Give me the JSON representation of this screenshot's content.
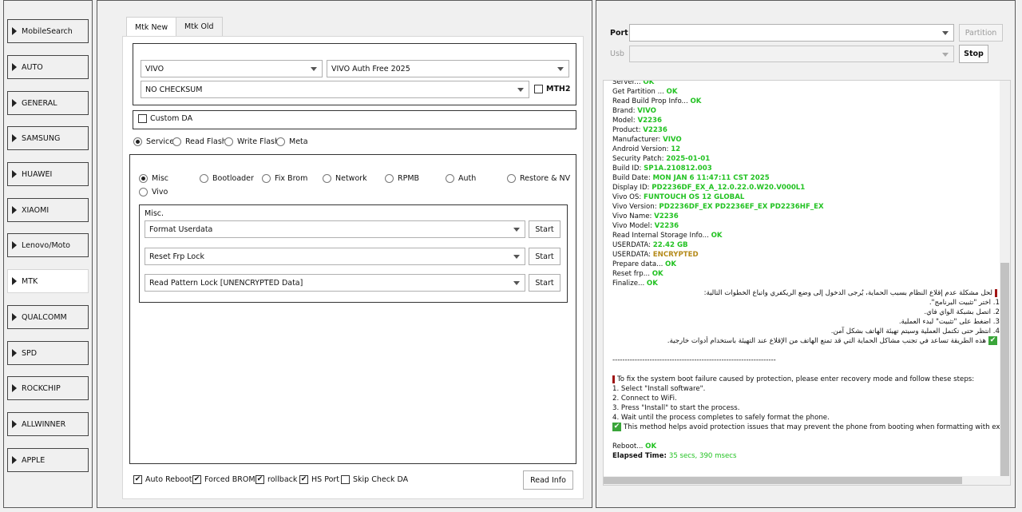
{
  "sidebar": {
    "items": [
      {
        "label": "MobileSearch"
      },
      {
        "label": "AUTO"
      },
      {
        "label": "GENERAL"
      },
      {
        "label": "SAMSUNG"
      },
      {
        "label": "HUAWEI"
      },
      {
        "label": "XIAOMI"
      },
      {
        "label": "Lenovo/Moto"
      },
      {
        "label": "MTK"
      },
      {
        "label": "QUALCOMM"
      },
      {
        "label": "SPD"
      },
      {
        "label": "ROCKCHIP"
      },
      {
        "label": "ALLWINNER"
      },
      {
        "label": "APPLE"
      }
    ],
    "active": "MTK"
  },
  "tabs": [
    {
      "label": "Mtk New"
    },
    {
      "label": "Mtk Old"
    }
  ],
  "device": {
    "brand": "VIVO",
    "auth": "VIVO Auth Free 2025",
    "checksum": "NO CHECKSUM",
    "mth2_label": "MTH2",
    "custom_da_label": "Custom DA"
  },
  "modes": [
    {
      "label": "Service",
      "selected": true
    },
    {
      "label": "Read Flash"
    },
    {
      "label": "Write Flash"
    },
    {
      "label": "Meta"
    }
  ],
  "ops": [
    {
      "label": "Misc",
      "selected": true
    },
    {
      "label": "Bootloader"
    },
    {
      "label": "Fix Brom"
    },
    {
      "label": "Network"
    },
    {
      "label": "RPMB"
    },
    {
      "label": "Auth"
    },
    {
      "label": "Restore & NV"
    },
    {
      "label": "Vivo"
    }
  ],
  "misc": {
    "title": "Misc.",
    "rows": [
      {
        "value": "Format Userdata",
        "button": "Start"
      },
      {
        "value": "Reset Frp Lock",
        "button": "Start"
      },
      {
        "value": "Read Pattern Lock [UNENCRYPTED Data]",
        "button": "Start"
      }
    ]
  },
  "bottom": {
    "options": [
      {
        "label": "Auto Reboot",
        "checked": true
      },
      {
        "label": "Forced BROM",
        "checked": true
      },
      {
        "label": "rollback",
        "checked": true
      },
      {
        "label": "HS Port",
        "checked": true
      },
      {
        "label": "Skip Check DA",
        "checked": false
      }
    ],
    "read_info": "Read Info"
  },
  "right": {
    "port_label": "Port",
    "usb_label": "Usb",
    "partition_button": "Partition",
    "stop_button": "Stop"
  },
  "log": {
    "lines": [
      {
        "t": "Server... ",
        "v": "OK",
        "c": "ok"
      },
      {
        "t": "Get Partition ... ",
        "v": "OK",
        "c": "ok"
      },
      {
        "t": "Read Build Prop Info... ",
        "v": "OK",
        "c": "ok"
      },
      {
        "t": " Brand: ",
        "v": "VIVO",
        "c": "ok"
      },
      {
        "t": " Model: ",
        "v": "V2236",
        "c": "ok"
      },
      {
        "t": " Product: ",
        "v": "V2236",
        "c": "ok"
      },
      {
        "t": " Manufacturer: ",
        "v": "VIVO",
        "c": "ok"
      },
      {
        "t": " Android Version: ",
        "v": "12",
        "c": "ok"
      },
      {
        "t": " Security Patch: ",
        "v": "2025-01-01",
        "c": "ok"
      },
      {
        "t": " Build ID: ",
        "v": "SP1A.210812.003",
        "c": "ok"
      },
      {
        "t": " Build Date: ",
        "v": "MON JAN  6 11:47:11 CST 2025",
        "c": "ok"
      },
      {
        "t": " Display ID: ",
        "v": "PD2236DF_EX_A_12.0.22.0.W20.V000L1",
        "c": "ok"
      },
      {
        "t": " Vivo OS: ",
        "v": "FUNTOUCH OS 12 GLOBAL",
        "c": "ok"
      },
      {
        "t": " Vivo Version: ",
        "v": "PD2236DF_EX PD2236EF_EX PD2236HF_EX",
        "c": "ok"
      },
      {
        "t": " Vivo Name: ",
        "v": "V2236",
        "c": "ok"
      },
      {
        "t": " Vivo Model: ",
        "v": "V2236",
        "c": "ok"
      },
      {
        "t": "Read Internal Storage Info... ",
        "v": "OK",
        "c": "ok"
      },
      {
        "t": "USERDATA: ",
        "v": "22.42 GB",
        "c": "ok"
      },
      {
        "t": "USERDATA: ",
        "v": "ENCRYPTED",
        "c": "enc"
      },
      {
        "t": "Prepare data... ",
        "v": "OK",
        "c": "ok"
      },
      {
        "t": "Reset frp... ",
        "v": "OK",
        "c": "ok"
      },
      {
        "t": "Finalize... ",
        "v": "OK",
        "c": "ok"
      }
    ],
    "arabic": [
      "لحل مشكلة عدم إقلاع النظام بسبب الحماية، يُرجى الدخول إلى وضع الريكفري واتباع الخطوات التالية:",
      "1. اختر \"تثبيت البرنامج\".",
      "2. اتصل بشبكة الواي فاي.",
      "3. اضغط على \"تثبيت\" لبدء العملية.",
      "4. انتظر حتى تكتمل العملية وسيتم تهيئة الهاتف بشكل آمن.",
      "هذه الطريقة تساعد في تجنب مشاكل الحماية التي قد تمنع الهاتف من الإقلاع عند التهيئة باستخدام أدوات خارجية."
    ],
    "separator": "------------------------------------------------------------------",
    "english": [
      "To fix the system boot failure caused by protection, please enter recovery mode and follow these steps:",
      "1. Select \"Install software\".",
      "2. Connect to WiFi.",
      "3. Press \"Install\" to start the process.",
      "4. Wait until the process completes to safely format the phone.",
      "This method helps avoid protection issues that may prevent the phone from booting when formatting with ex"
    ],
    "reboot": {
      "t": "Reboot... ",
      "v": "OK"
    },
    "elapsed": {
      "t": "Elapsed Time: ",
      "v": "35 secs, 390 msecs"
    }
  }
}
